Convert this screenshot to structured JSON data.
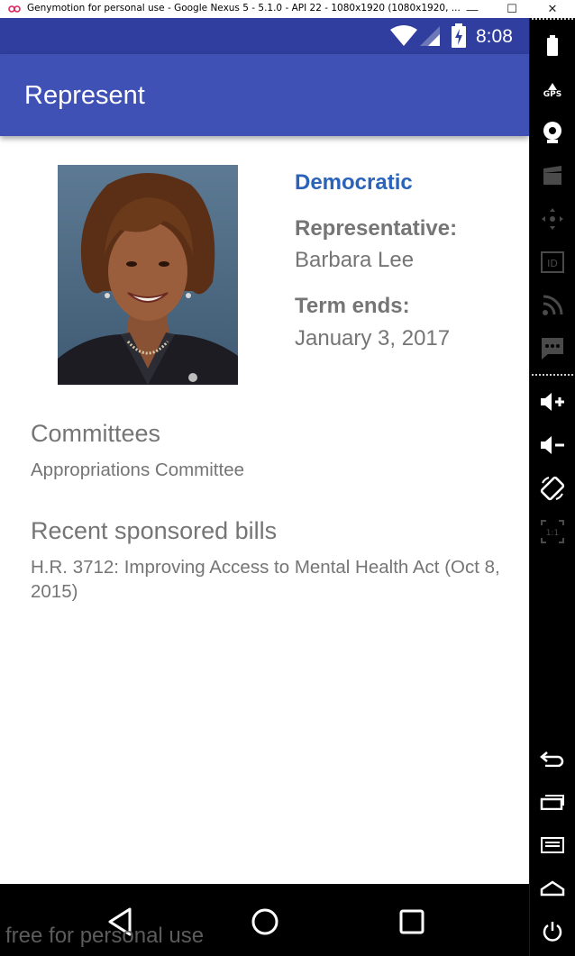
{
  "window": {
    "title": "Genymotion for personal use - Google Nexus 5 - 5.1.0 - API 22 - 1080x1920 (1080x1920, ...",
    "controls": {
      "minimize": "—",
      "maximize": "☐",
      "close": "✕"
    }
  },
  "status_bar": {
    "time": "8:08",
    "icons": [
      "wifi-icon",
      "signal-icon",
      "battery-charging-icon"
    ]
  },
  "app": {
    "title": "Represent"
  },
  "representative": {
    "party": "Democratic",
    "role_label": "Representative:",
    "name": "Barbara Lee",
    "term_label": "Term ends:",
    "term_end": "January 3, 2017"
  },
  "committees": {
    "heading": "Committees",
    "items": [
      "Appropriations Committee"
    ]
  },
  "bills": {
    "heading": "Recent sponsored bills",
    "items": [
      "H.R. 3712: Improving Access to Mental Health Act (Oct 8, 2015)"
    ]
  },
  "nav": {
    "buttons": [
      "back-icon",
      "home-icon",
      "recents-icon"
    ]
  },
  "watermark": "free for personal use",
  "sidebar": {
    "tools": [
      "battery-icon",
      "gps-icon",
      "camera-icon",
      "video-capture-icon",
      "remote-control-icon",
      "device-id-icon",
      "network-icon",
      "sms-icon",
      "volume-up-icon",
      "volume-down-icon",
      "rotate-icon",
      "pixel-perfect-icon",
      "back-icon",
      "recent-apps-icon",
      "menu-icon",
      "home-icon",
      "power-icon"
    ],
    "gps_label": "GPS",
    "id_label": "ID",
    "pixel_label": "1:1"
  },
  "colors": {
    "status_bar": "#303f9f",
    "app_bar": "#3f51b5",
    "party_text": "#2a63b9",
    "body_text": "#757575"
  }
}
